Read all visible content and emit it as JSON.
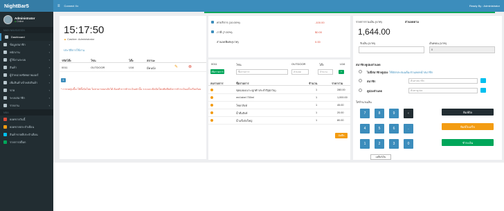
{
  "brand": "NightBar5",
  "topbar": {
    "menu_icon": "hamburger-icon",
    "connect_label": "Connect Xx",
    "ready_label": "Ready By : Administrator"
  },
  "user": {
    "name": "Administrator",
    "status": "Online"
  },
  "sidebar": {
    "section1": "MAIN NAVIGATION",
    "items": [
      {
        "label": "Dashboard",
        "icon": "dashboard-icon"
      },
      {
        "label": "ข้อมูลสมาชิก",
        "icon": "users-icon"
      },
      {
        "label": "พนักงาน",
        "icon": "staff-icon"
      },
      {
        "label": "ผู้ใช้งานระบบ",
        "icon": "user-cog-icon"
      },
      {
        "label": "สินค้า",
        "icon": "box-icon"
      },
      {
        "label": "ผู้จำหน่าย/ซัพพลายเออร์",
        "icon": "truck-icon"
      },
      {
        "label": "เพิ่มสินค้าเข้าคลังสินค้า",
        "icon": "warehouse-icon"
      },
      {
        "label": "ขาย",
        "icon": "cart-icon"
      },
      {
        "label": "ระบบสมาชิก",
        "icon": "member-icon"
      },
      {
        "label": "รายงาน",
        "icon": "report-icon"
      }
    ],
    "section2": "MBA",
    "items2": [
      {
        "label": "ยอดขายวันนี้",
        "icon": "chart-icon"
      },
      {
        "label": "ยอดขายประจำเดือน",
        "icon": "calendar-icon"
      },
      {
        "label": "สินค้าขายดีประจำเดือน",
        "icon": "star-icon"
      },
      {
        "label": "รายการสต็อก",
        "icon": "list-icon"
      }
    ]
  },
  "clock": {
    "time": "15:17:50",
    "cashier_prefix": "Cashier:",
    "cashier": "Administrator",
    "link": "ประวัติการใช้งาน"
  },
  "tables_table": {
    "headers": [
      "รหัสโต๊ะ",
      "โซน",
      "โต๊ะ",
      "สถานะ"
    ],
    "row": {
      "code": "0011",
      "zone": "OUTDOOR",
      "table": "U16",
      "status": "มีคนนั่ง"
    }
  },
  "pagination": "1",
  "note": "* การกดปุ่มนี้จะให้ตั้งบิลใหม่ ไม่สามารถยกเลิกได้ ต้องทำการชำระเงินเท่านั้น ระบบจะเปิดบิลใหม่ทันทีหลังการชำระเงินเสร็จเรียบร้อย",
  "charges": [
    {
      "label": "ค่าบริการ (10.00%)",
      "value": "-100.00"
    },
    {
      "label": "ภาษี (7.00%)",
      "value": "$0.00"
    },
    {
      "label": "ส่วนลดพิเศษ(บาท)",
      "value": "0.00"
    }
  ],
  "bill": {
    "code": "0011",
    "zone_label": "โซน",
    "zone": "OUTDOOR",
    "table_label": "โต๊ะ",
    "table": "U16",
    "add_btn": "เพิ่มรายการ",
    "search_ph": "ชื่อรายการ",
    "disc_ph": "ส่วนลด",
    "qty_ph": "จำนวน"
  },
  "items_header": [
    "ลบรายการ",
    "ชื่อรายการ",
    "จำนวน",
    "ราคารวม"
  ],
  "items": [
    {
      "name": "ชุดฉลองเบาะ/ลูกค้าประจำปี(ทุกวัน)",
      "qty": "1",
      "total": "280.00"
    },
    {
      "name": "red label 700ml",
      "qty": "1",
      "total": "1,000.00"
    },
    {
      "name": "โซดาสิงห์",
      "qty": "1",
      "total": "45.00"
    },
    {
      "name": "น้ำดื่มสิงห์",
      "qty": "1",
      "total": "20.00"
    },
    {
      "name": "น้ำแข็งถังใหญ่",
      "qty": "1",
      "total": "80.00"
    }
  ],
  "save_btn": "บันทึก",
  "summary": {
    "title": "รายการรวมเงิน (บาท)",
    "discount_tag": "ส่วนลดตาม",
    "total": "1,644.00",
    "received_label": "รับเงิน (บาท)",
    "change_label": "เงินทอน (บาท)",
    "change": "0"
  },
  "member": {
    "title": "สมาชิก/คูปองส่วนลด",
    "opt1": "ไม่มีสมาชิก/คูปอง",
    "opt1_link": "ใช้บัตรสะสมแต้ม/ส่วนลดหน้าสมาชิก",
    "opt2": "สมาชิก",
    "opt2_ph": "ค้นหาสมาชิก",
    "opt3": "คูปองส่วนลด",
    "opt3_ph": "ค้นหาคูปอง",
    "numpad_label": "ใส่จำนวนเงิน"
  },
  "keys": [
    "7",
    "8",
    "9",
    "‹",
    "4",
    "5",
    "6",
    ".",
    "1",
    "2",
    "3",
    "0"
  ],
  "actions": {
    "print": "พิมพ์บิล",
    "print_receipt": "พิมพ์ใบเสร็จ",
    "pay": "ชำระเงิน",
    "clear": "เคลียร์เงิน"
  },
  "colors": {
    "header": "#3c8dbc",
    "sidebar": "#222d32",
    "green": "#00a65a",
    "orange": "#f39c12",
    "red": "#dd4b39",
    "aqua": "#00c0ef"
  }
}
